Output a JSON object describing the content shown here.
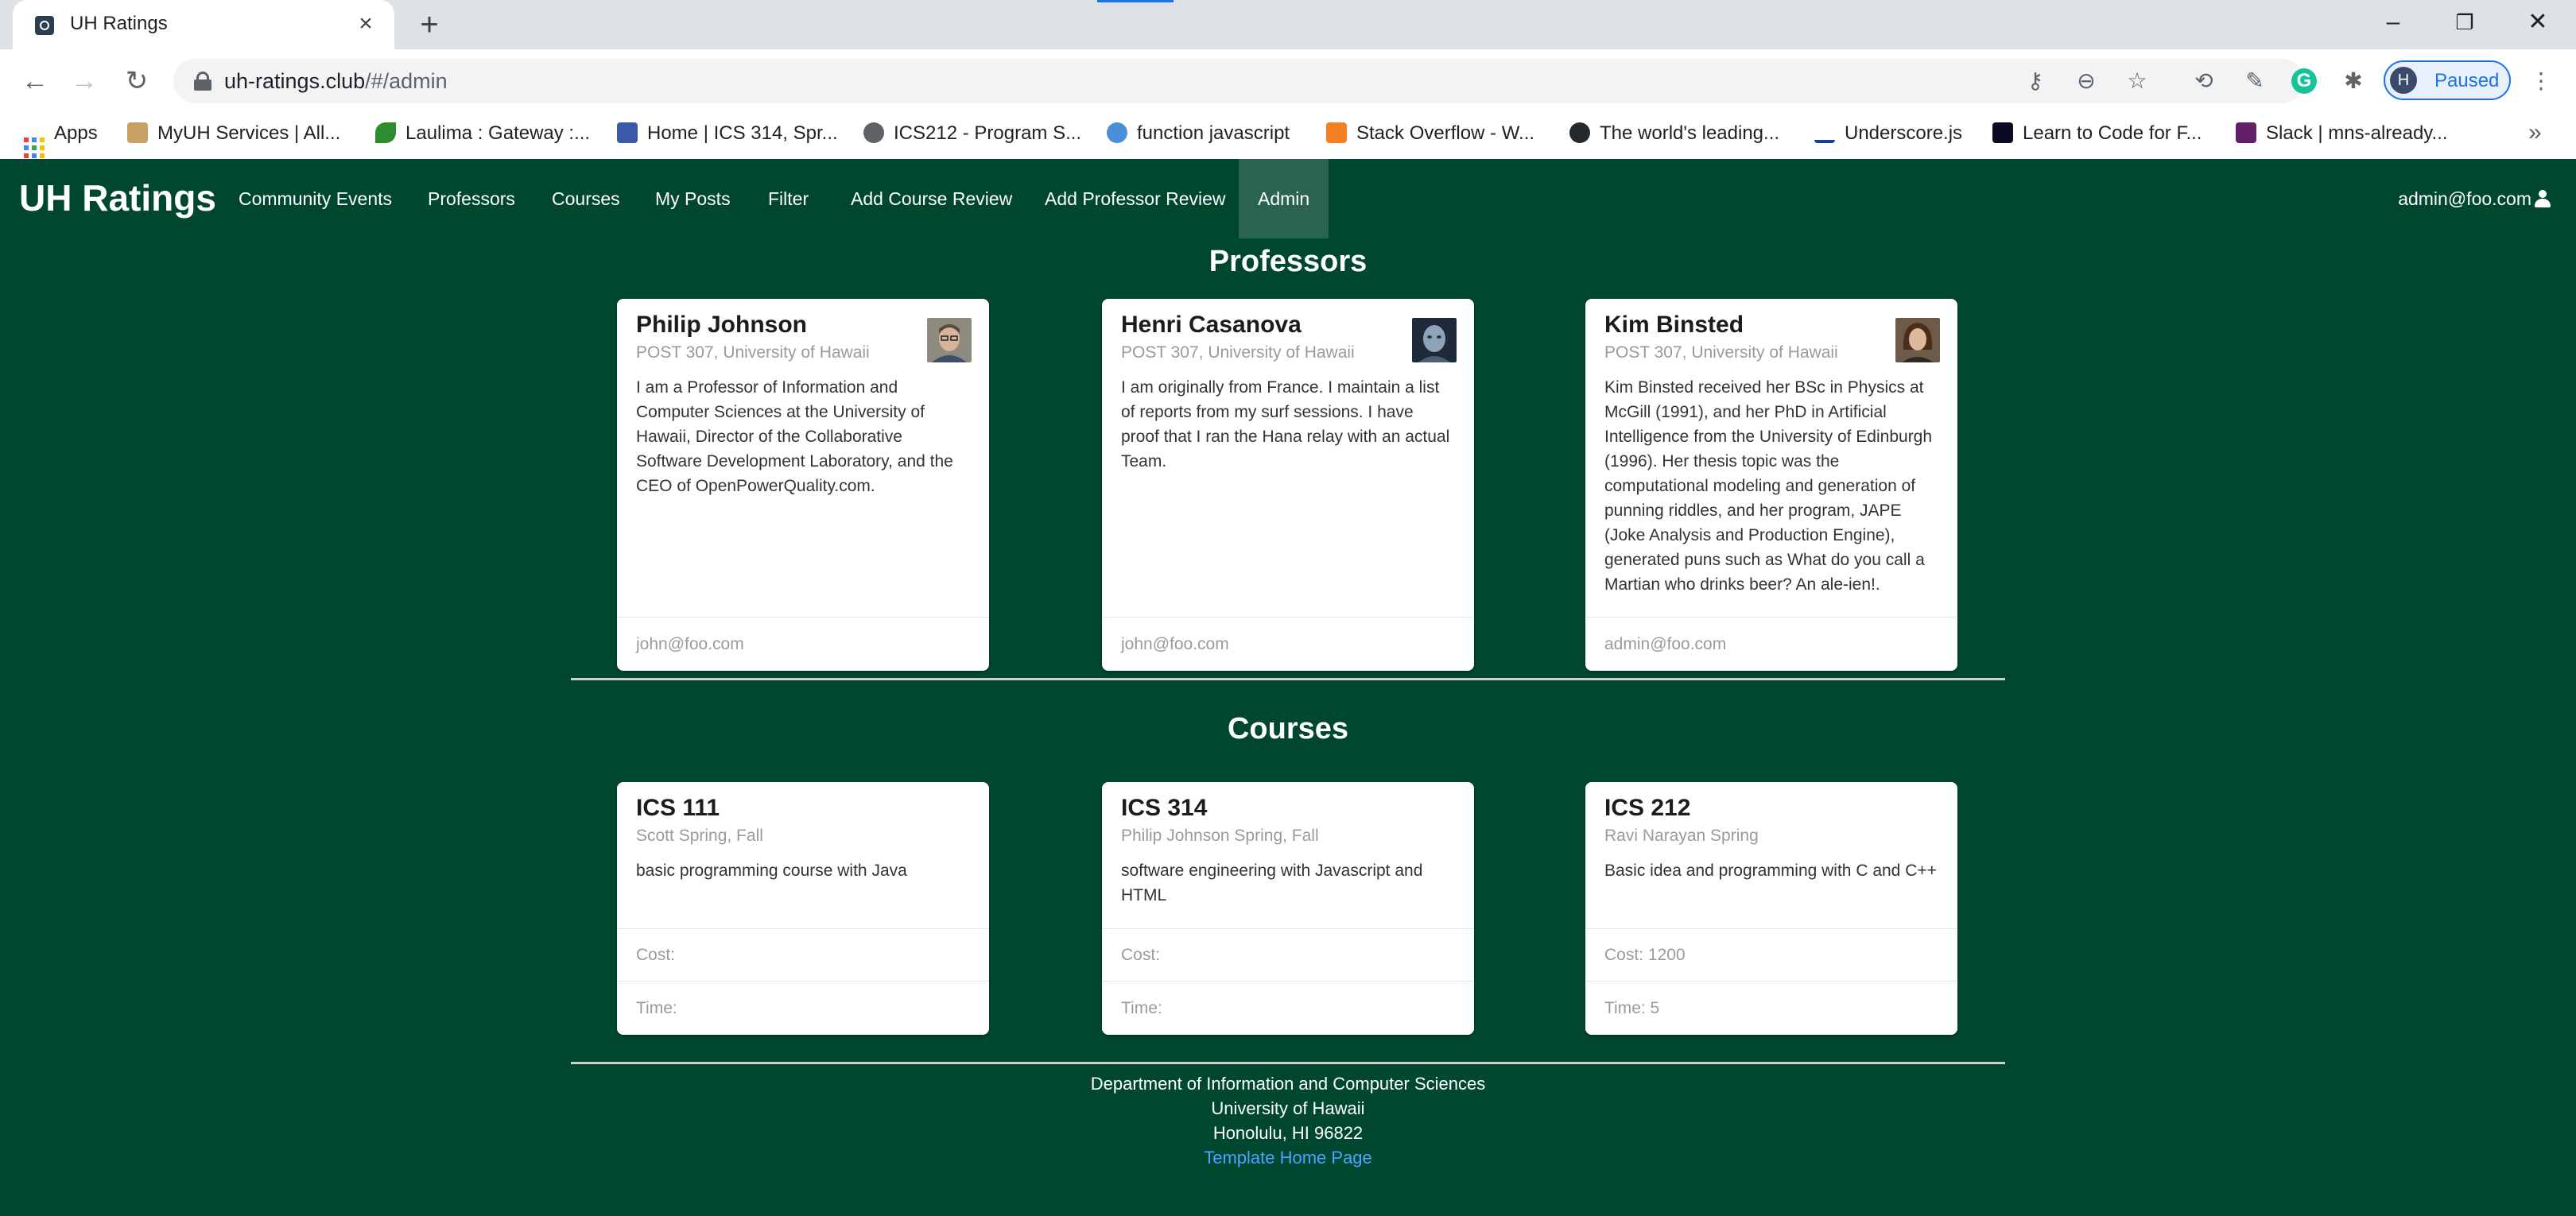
{
  "browser": {
    "tab_title": "UH Ratings",
    "url_host": "uh-ratings.club",
    "url_path": "/#/admin",
    "profile_initial": "H",
    "profile_status": "Paused",
    "bookmarks": [
      {
        "label": "Apps",
        "icon": "apps-grid-icon"
      },
      {
        "label": "MyUH Services | All...",
        "icon": "uh-logo-icon",
        "color": "#c8a165"
      },
      {
        "label": "Laulima : Gateway :...",
        "icon": "leaf-icon",
        "color": "#2e8b2e"
      },
      {
        "label": "Home | ICS 314, Spr...",
        "icon": "page-icon",
        "color": "#3a5aa8"
      },
      {
        "label": "ICS212 - Program S...",
        "icon": "globe-icon",
        "color": "#5f6368"
      },
      {
        "label": "function javascript",
        "icon": "cloud-icon",
        "color": "#4a90d9"
      },
      {
        "label": "Stack Overflow - W...",
        "icon": "stackoverflow-icon",
        "color": "#f48024"
      },
      {
        "label": "The world's leading...",
        "icon": "github-icon",
        "color": "#24292e"
      },
      {
        "label": "Underscore.js",
        "icon": "underscore-icon",
        "color": "#1a3e96"
      },
      {
        "label": "Learn to Code for F...",
        "icon": "freecodecamp-icon",
        "color": "#0a0a23"
      },
      {
        "label": "Slack | mns-already...",
        "icon": "slack-icon",
        "color": "#611f69"
      }
    ]
  },
  "navbar": {
    "brand": "UH Ratings",
    "items": [
      "Community Events",
      "Professors",
      "Courses",
      "My Posts",
      "Filter",
      "Add Course Review",
      "Add Professor Review",
      "Admin"
    ],
    "active": "Admin",
    "user": "admin@foo.com"
  },
  "professors_section": {
    "title": "Professors",
    "cards": [
      {
        "name": "Philip Johnson",
        "meta": "POST 307, University of Hawaii",
        "description": "I am a Professor of Information and Computer Sciences at the University of Hawaii, Director of the Collaborative Software Development Laboratory, and the CEO of OpenPowerQuality.com.",
        "email": "john@foo.com"
      },
      {
        "name": "Henri Casanova",
        "meta": "POST 307, University of Hawaii",
        "description": "I am originally from France. I maintain a list of reports from my surf sessions. I have proof that I ran the Hana relay with an actual Team.",
        "email": "john@foo.com"
      },
      {
        "name": "Kim Binsted",
        "meta": "POST 307, University of Hawaii",
        "description": "Kim Binsted received her BSc in Physics at McGill (1991), and her PhD in Artificial Intelligence from the University of Edinburgh (1996). Her thesis topic was the computational modeling and generation of punning riddles, and her program, JAPE (Joke Analysis and Production Engine), generated puns such as What do you call a Martian who drinks beer? An ale-ien!.",
        "email": "admin@foo.com"
      }
    ]
  },
  "courses_section": {
    "title": "Courses",
    "cards": [
      {
        "name": "ICS 111",
        "meta": "Scott Spring, Fall",
        "description": "basic programming course with Java",
        "cost": "Cost:",
        "time": "Time:"
      },
      {
        "name": "ICS 314",
        "meta": "Philip Johnson Spring, Fall",
        "description": "software engineering with Javascript and HTML",
        "cost": "Cost:",
        "time": "Time:"
      },
      {
        "name": "ICS 212",
        "meta": "Ravi Narayan Spring",
        "description": "Basic idea and programming with C and C++",
        "cost": "Cost: 1200",
        "time": "Time: 5"
      }
    ]
  },
  "footer": {
    "line1": "Department of Information and Computer Sciences",
    "line2": "University of Hawaii",
    "line3": "Honolulu, HI 96822",
    "link": "Template Home Page"
  }
}
